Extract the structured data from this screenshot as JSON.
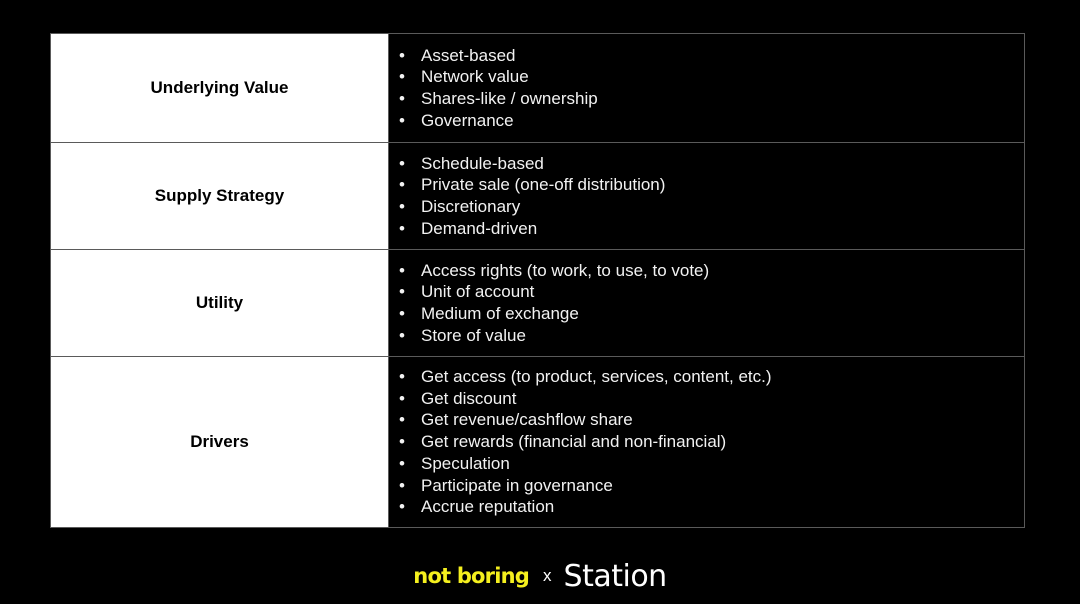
{
  "table": {
    "rows": [
      {
        "label": "Underlying Value",
        "items": [
          "Asset-based",
          "Network value",
          "Shares-like / ownership",
          "Governance"
        ]
      },
      {
        "label": "Supply Strategy",
        "items": [
          "Schedule-based",
          "Private sale (one-off distribution)",
          "Discretionary",
          "Demand-driven"
        ]
      },
      {
        "label": "Utility",
        "items": [
          "Access rights (to work, to use, to vote)",
          "Unit of account",
          "Medium of exchange",
          "Store of value"
        ]
      },
      {
        "label": "Drivers",
        "items": [
          "Get access (to product, services, content, etc.)",
          "Get discount",
          "Get revenue/cashflow share",
          "Get rewards (financial and non-financial)",
          "Speculation",
          "Participate in governance",
          "Accrue reputation"
        ]
      }
    ]
  },
  "footer": {
    "brand_left": "not boring",
    "separator": "x",
    "brand_right": "Station",
    "brand_left_color": "#f5f01e"
  }
}
